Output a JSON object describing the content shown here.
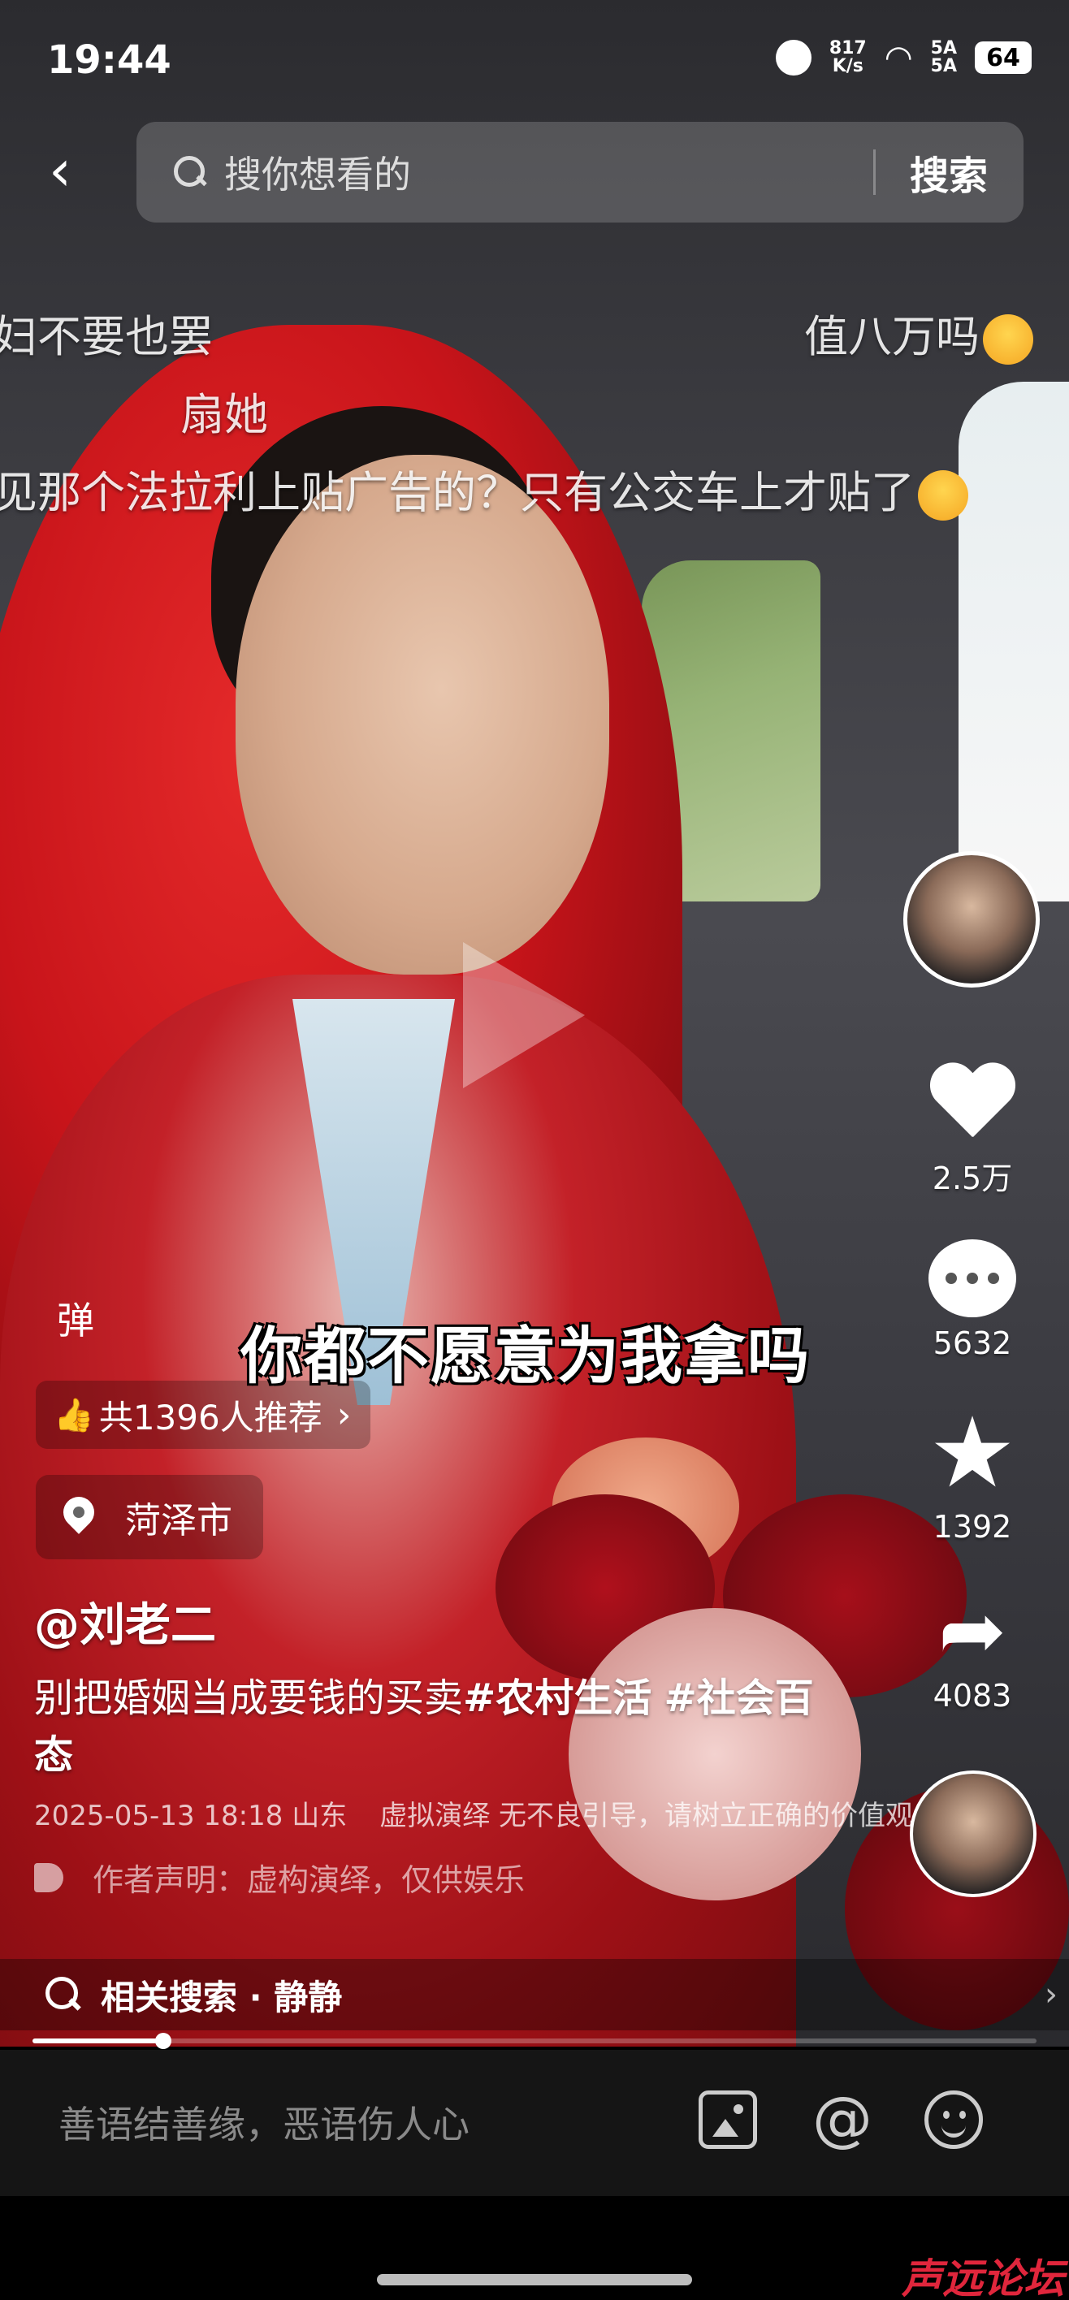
{
  "status_bar": {
    "time": "19:44",
    "net_speed": "817",
    "net_unit": "K/s",
    "sig1": "5A",
    "sig2": "5A",
    "battery": "64"
  },
  "search": {
    "placeholder": "搜你想看的",
    "button": "搜索"
  },
  "danmaku": [
    "妇不要也罢",
    "值八万吗",
    "扇她",
    "见那个法拉利上贴广告的？只有公交车上才贴了"
  ],
  "actions": {
    "likes": "2.5万",
    "comments": "5632",
    "favorites": "1392",
    "shares": "4083"
  },
  "info": {
    "danmu_toggle": "弹",
    "recommend": "共1396人推荐",
    "location": "菏泽市",
    "author": "@刘老二",
    "caption_text": "别把婚姻当成要钱的买卖",
    "tag1": "#农村生活",
    "tag2": "#社会百态",
    "datetime": "2025-05-13 18:18 山东",
    "notice": "虚拟演绎 无不良引导，请树立正确的价值观",
    "declaration": "作者声明：虚构演绎，仅供娱乐"
  },
  "subtitle": "你都不愿意为我拿吗",
  "related_search": "相关搜索 · 静静",
  "progress_fraction": 0.13,
  "comment_input_placeholder": "善语结善缘，恶语伤人心",
  "watermark": "声远论坛"
}
